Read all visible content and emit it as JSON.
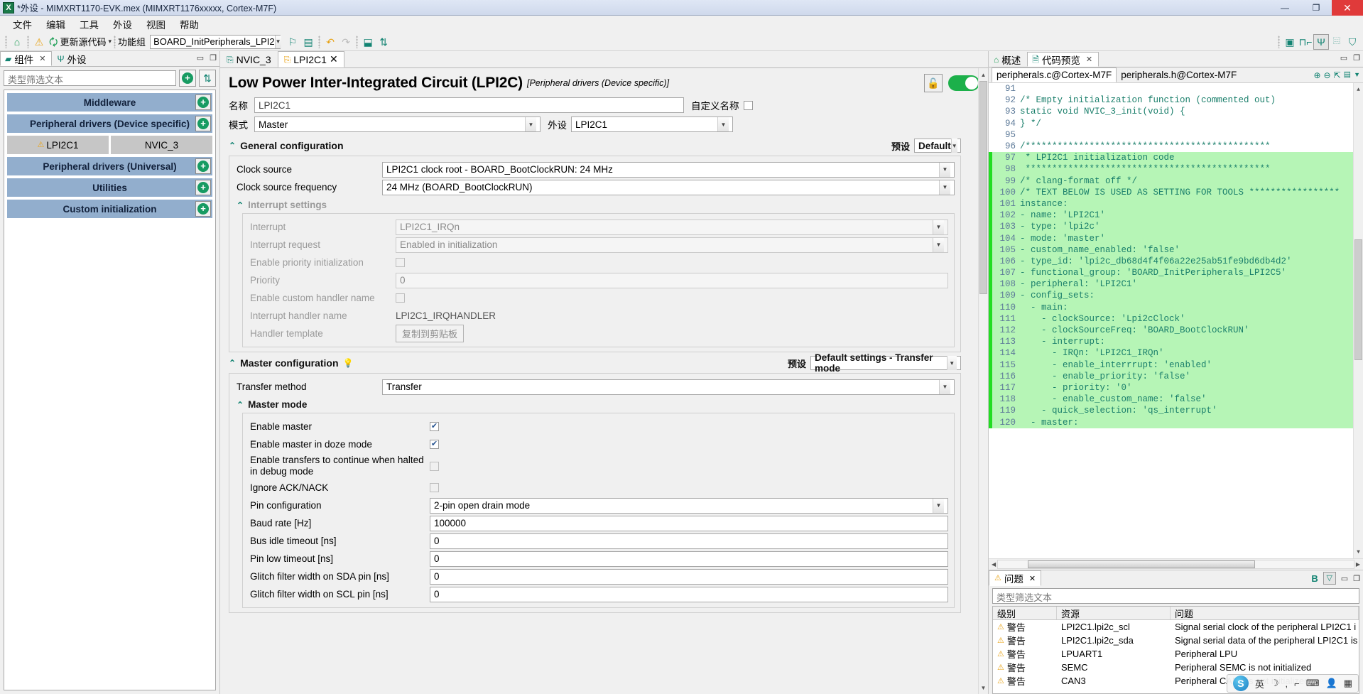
{
  "window": {
    "title": "*外设 - MIMXRT1170-EVK.mex (MIMXRT1176xxxxx, Cortex-M7F)",
    "app_icon": "X",
    "minimize": "—",
    "maximize": "❐",
    "close": "✕"
  },
  "menubar": {
    "items": [
      "文件",
      "编辑",
      "工具",
      "外设",
      "视图",
      "帮助"
    ]
  },
  "toolbar": {
    "home_icon": "home-icon",
    "warning_icon": "warning-icon",
    "update_source_label": "更新源代码",
    "dropdown_caret": "▾",
    "functional_group_label": "功能组",
    "functional_group_value": "BOARD_InitPeripherals_LPI2",
    "right_icons": [
      "chip-icon",
      "pin-signal-icon",
      "peripherals-icon",
      "binary-icon",
      "security-icon"
    ]
  },
  "left_panel": {
    "tabs": [
      {
        "label": "组件",
        "icon": "components-icon",
        "active": true,
        "closable": true
      },
      {
        "label": "外设",
        "icon": "peripherals-icon",
        "active": false,
        "closable": false
      }
    ],
    "filter_placeholder": "类型筛选文本",
    "add_button": "add-icon",
    "sort_button": "sort-icon",
    "groups": [
      {
        "label": "Middleware",
        "children": []
      },
      {
        "label": "Peripheral drivers (Device specific)",
        "children": [
          {
            "label": "LPI2C1",
            "warning": true,
            "selected": true
          },
          {
            "label": "NVIC_3",
            "warning": false,
            "selected": false
          }
        ]
      },
      {
        "label": "Peripheral drivers (Universal)",
        "children": []
      },
      {
        "label": "Utilities",
        "children": []
      },
      {
        "label": "Custom initialization",
        "children": []
      }
    ]
  },
  "editor": {
    "tabs": [
      {
        "label": "NVIC_3",
        "active": false,
        "closable": false
      },
      {
        "label": "LPI2C1",
        "active": true,
        "closable": true
      }
    ],
    "title": "Low Power Inter-Integrated Circuit (LPI2C)",
    "subtitle": "[Peripheral drivers (Device specific)]",
    "lock_icon": "unlock-icon",
    "toggle_on": true,
    "name_label": "名称",
    "name_value": "LPI2C1",
    "custom_name_label": "自定义名称",
    "custom_name_checked": false,
    "mode_label": "模式",
    "mode_value": "Master",
    "peripheral_label": "外设",
    "peripheral_value": "LPI2C1",
    "general": {
      "title": "General configuration",
      "preset_label": "预设",
      "preset_value": "Default",
      "rows": [
        {
          "label": "Clock source",
          "value": "LPI2C1 clock root - BOARD_BootClockRUN: 24 MHz",
          "type": "select",
          "disabled": false
        },
        {
          "label": "Clock source frequency",
          "value": "24 MHz (BOARD_BootClockRUN)",
          "type": "select",
          "disabled": false
        }
      ],
      "interrupt": {
        "title": "Interrupt settings",
        "rows": [
          {
            "label": "Interrupt",
            "value": "LPI2C1_IRQn",
            "type": "select",
            "disabled": true
          },
          {
            "label": "Interrupt request",
            "value": "Enabled in initialization",
            "type": "select",
            "disabled": true
          },
          {
            "label": "Enable priority initialization",
            "value": "",
            "type": "checkbox",
            "checked": false,
            "disabled": true
          },
          {
            "label": "Priority",
            "value": "0",
            "type": "text",
            "disabled": true
          },
          {
            "label": "Enable custom handler name",
            "value": "",
            "type": "checkbox",
            "checked": false,
            "disabled": true
          },
          {
            "label": "Interrupt handler name",
            "value": "LPI2C1_IRQHANDLER",
            "type": "plain",
            "disabled": true
          },
          {
            "label": "Handler template",
            "value": "复制到剪贴板",
            "type": "button",
            "disabled": true
          }
        ]
      }
    },
    "master": {
      "title": "Master configuration",
      "hint_icon": "bulb-icon",
      "preset_label": "预设",
      "preset_value": "Default settings - Transfer mode",
      "transfer_method_label": "Transfer method",
      "transfer_method_value": "Transfer",
      "mode_section_title": "Master mode",
      "rows": [
        {
          "label": "Enable master",
          "type": "checkbox",
          "checked": true
        },
        {
          "label": "Enable master in doze mode",
          "type": "checkbox",
          "checked": true
        },
        {
          "label": "Enable transfers to continue when halted in debug mode",
          "type": "checkbox",
          "checked": false
        },
        {
          "label": "Ignore ACK/NACK",
          "type": "checkbox",
          "checked": false
        },
        {
          "label": "Pin configuration",
          "type": "select",
          "value": "2-pin open drain mode"
        },
        {
          "label": "Baud rate [Hz]",
          "type": "text",
          "value": "100000"
        },
        {
          "label": "Bus idle timeout [ns]",
          "type": "text",
          "value": "0"
        },
        {
          "label": "Pin low timeout [ns]",
          "type": "text",
          "value": "0"
        },
        {
          "label": "Glitch filter width on SDA pin [ns]",
          "type": "text",
          "value": "0"
        },
        {
          "label": "Glitch filter width on SCL pin [ns]",
          "type": "text",
          "value": "0"
        }
      ]
    }
  },
  "right_panel": {
    "tabs": [
      {
        "label": "概述",
        "icon": "home-icon",
        "active": false,
        "closable": false
      },
      {
        "label": "代码预览",
        "icon": "code-file-icon",
        "active": true,
        "closable": true
      }
    ],
    "file_tabs": [
      {
        "label": "peripherals.c@Cortex-M7F",
        "active": true
      },
      {
        "label": "peripherals.h@Cortex-M7F",
        "active": false
      }
    ],
    "toolbar_icons": [
      "zoom-in-icon",
      "zoom-out-icon",
      "export-icon",
      "menu-icon",
      "chevron-down-icon"
    ],
    "code": [
      {
        "n": "91",
        "text": "",
        "hl": false
      },
      {
        "n": "92",
        "text": "/* Empty initialization function (commented out)",
        "hl": false
      },
      {
        "n": "93",
        "text": "static void NVIC_3_init(void) {",
        "hl": false
      },
      {
        "n": "94",
        "text": "} */",
        "hl": false
      },
      {
        "n": "95",
        "text": "",
        "hl": false
      },
      {
        "n": "96",
        "text": "/**********************************************",
        "hl": false
      },
      {
        "n": "97",
        "text": " * LPI2C1 initialization code",
        "hl": true
      },
      {
        "n": "98",
        "text": " **********************************************",
        "hl": true
      },
      {
        "n": "99",
        "text": "/* clang-format off */",
        "hl": true
      },
      {
        "n": "100",
        "text": "/* TEXT BELOW IS USED AS SETTING FOR TOOLS *****************",
        "hl": true
      },
      {
        "n": "101",
        "text": "instance:",
        "hl": true
      },
      {
        "n": "102",
        "text": "- name: 'LPI2C1'",
        "hl": true
      },
      {
        "n": "103",
        "text": "- type: 'lpi2c'",
        "hl": true
      },
      {
        "n": "104",
        "text": "- mode: 'master'",
        "hl": true
      },
      {
        "n": "105",
        "text": "- custom_name_enabled: 'false'",
        "hl": true
      },
      {
        "n": "106",
        "text": "- type_id: 'lpi2c_db68d4f4f06a22e25ab51fe9bd6db4d2'",
        "hl": true
      },
      {
        "n": "107",
        "text": "- functional_group: 'BOARD_InitPeripherals_LPI2C5'",
        "hl": true
      },
      {
        "n": "108",
        "text": "- peripheral: 'LPI2C1'",
        "hl": true
      },
      {
        "n": "109",
        "text": "- config_sets:",
        "hl": true
      },
      {
        "n": "110",
        "text": "  - main:",
        "hl": true
      },
      {
        "n": "111",
        "text": "    - clockSource: 'Lpi2cClock'",
        "hl": true
      },
      {
        "n": "112",
        "text": "    - clockSourceFreq: 'BOARD_BootClockRUN'",
        "hl": true
      },
      {
        "n": "113",
        "text": "    - interrupt:",
        "hl": true
      },
      {
        "n": "114",
        "text": "      - IRQn: 'LPI2C1_IRQn'",
        "hl": true
      },
      {
        "n": "115",
        "text": "      - enable_interrrupt: 'enabled'",
        "hl": true
      },
      {
        "n": "116",
        "text": "      - enable_priority: 'false'",
        "hl": true
      },
      {
        "n": "117",
        "text": "      - priority: '0'",
        "hl": true
      },
      {
        "n": "118",
        "text": "      - enable_custom_name: 'false'",
        "hl": true
      },
      {
        "n": "119",
        "text": "    - quick_selection: 'qs_interrupt'",
        "hl": true
      },
      {
        "n": "120",
        "text": "  - master:",
        "hl": true
      }
    ]
  },
  "problems": {
    "tab_label": "问题",
    "tab_icon": "problems-icon",
    "toolbar_b": "B",
    "filter_icon": "filter-icon",
    "filter_placeholder": "类型筛选文本",
    "columns": [
      "级别",
      "资源",
      "问题"
    ],
    "rows": [
      {
        "level": "警告",
        "resource": "LPI2C1.lpi2c_scl",
        "problem": "Signal serial clock of the peripheral LPI2C1 i"
      },
      {
        "level": "警告",
        "resource": "LPI2C1.lpi2c_sda",
        "problem": "Signal serial data of the peripheral LPI2C1 is"
      },
      {
        "level": "警告",
        "resource": "LPUART1",
        "problem": "Peripheral LPU"
      },
      {
        "level": "警告",
        "resource": "SEMC",
        "problem": "Peripheral SEMC is not initialized"
      },
      {
        "level": "警告",
        "resource": "CAN3",
        "problem": "Peripheral CAN3 is not initialized"
      }
    ]
  },
  "ime": {
    "logo": "S",
    "mode": "英",
    "icons": [
      "moon-icon",
      "comma-icon",
      "half-width-icon",
      "keyboard-icon",
      "user-icon",
      "grid-icon"
    ]
  }
}
